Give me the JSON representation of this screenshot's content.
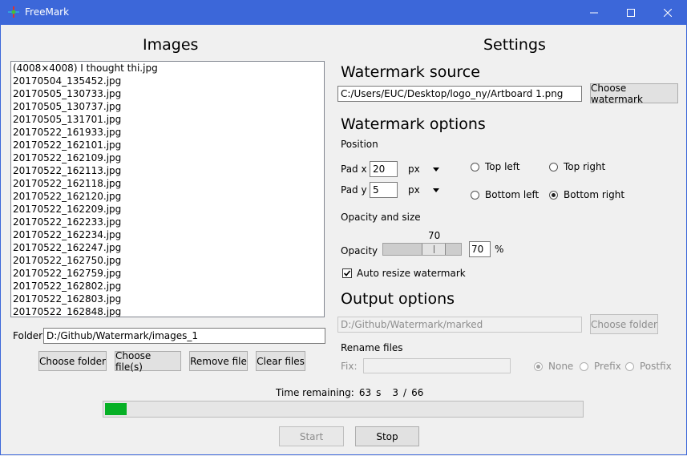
{
  "window": {
    "title": "FreeMark",
    "minimize": "—",
    "maximize": "☐",
    "close": "✕"
  },
  "images": {
    "heading": "Images",
    "files": [
      "(4008×4008) I thought thi.jpg",
      "20170504_135452.jpg",
      "20170505_130733.jpg",
      "20170505_130737.jpg",
      "20170505_131701.jpg",
      "20170522_161933.jpg",
      "20170522_162101.jpg",
      "20170522_162109.jpg",
      "20170522_162113.jpg",
      "20170522_162118.jpg",
      "20170522_162120.jpg",
      "20170522_162209.jpg",
      "20170522_162233.jpg",
      "20170522_162234.jpg",
      "20170522_162247.jpg",
      "20170522_162750.jpg",
      "20170522_162759.jpg",
      "20170522_162802.jpg",
      "20170522_162803.jpg",
      "20170522_162848.jpg"
    ],
    "folder_label": "Folder:",
    "folder_value": "D:/Github/Watermark/images_1",
    "buttons": {
      "choose_folder": "Choose folder",
      "choose_files": "Choose file(s)",
      "remove_file": "Remove file",
      "clear_files": "Clear files"
    }
  },
  "settings": {
    "heading": "Settings",
    "source": {
      "heading": "Watermark source",
      "path": "C:/Users/EUC/Desktop/logo_ny/Artboard 1.png",
      "button": "Choose watermark"
    },
    "options": {
      "heading": "Watermark options",
      "position_label": "Position",
      "pad_x_label": "Pad x",
      "pad_x_value": "20",
      "pad_x_unit": "px",
      "pad_y_label": "Pad y",
      "pad_y_value": "5",
      "pad_y_unit": "px",
      "positions": {
        "top_left": "Top left",
        "top_right": "Top right",
        "bottom_left": "Bottom left",
        "bottom_right": "Bottom right"
      },
      "selected_position": "bottom_right",
      "opacity_size_label": "Opacity and size",
      "opacity_label": "Opacity",
      "opacity_value": "70",
      "opacity_entry": "70",
      "opacity_percent": 70,
      "percent_sign": "%",
      "auto_resize_label": "Auto resize watermark",
      "auto_resize_checked": true
    },
    "output": {
      "heading": "Output options",
      "folder": "D:/Github/Watermark/marked",
      "choose_folder": "Choose folder",
      "rename_label": "Rename files",
      "fix_label": "Fix:",
      "fix_value": "",
      "modes": {
        "none": "None",
        "prefix": "Prefix",
        "postfix": "Postfix"
      },
      "selected_mode": "none"
    }
  },
  "progress": {
    "time_label": "Time remaining:",
    "time_value": "63",
    "time_unit": "s",
    "done": "3",
    "sep": "/",
    "total": "66",
    "fraction": 0.045,
    "fill_color": "#06b025"
  },
  "controls": {
    "start": "Start",
    "stop": "Stop"
  }
}
